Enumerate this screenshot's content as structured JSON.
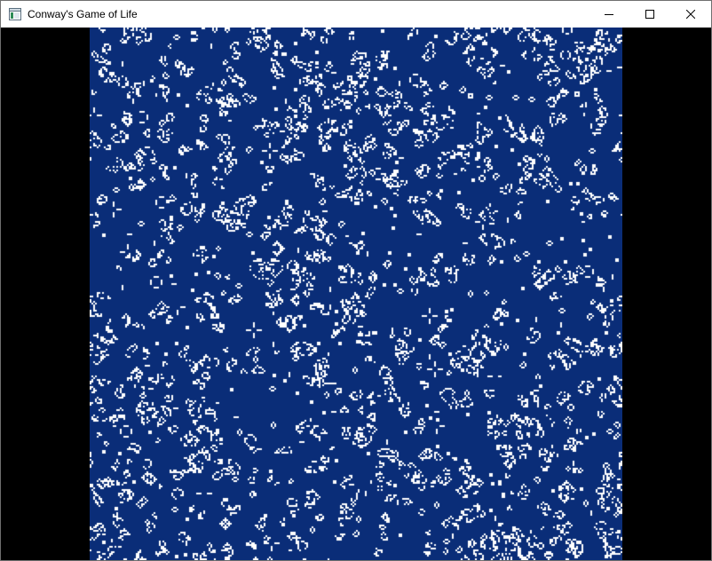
{
  "window": {
    "title": "Conway's Game of Life",
    "icon": "window-app-icon",
    "controls": [
      "minimize-icon",
      "maximize-icon",
      "close-icon"
    ]
  },
  "board": {
    "background_color": "#0a2d78",
    "cell_color": "#ffffff",
    "outside_color": "#000000"
  }
}
